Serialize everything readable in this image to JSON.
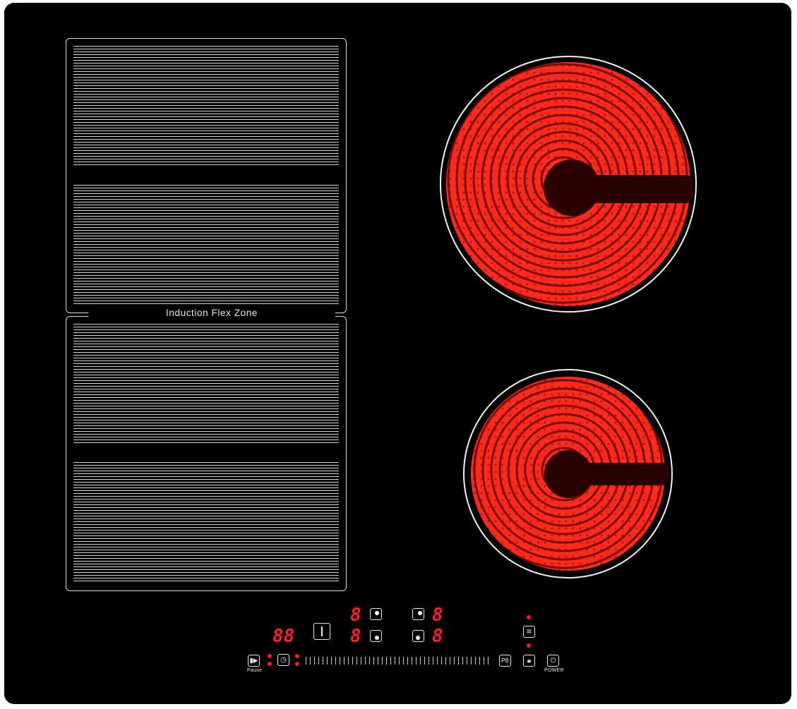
{
  "flex_zone": {
    "label": "Induction Flex Zone"
  },
  "controls": {
    "timer_display": "88",
    "zone_displays": {
      "front_left_top": "8",
      "front_left_bottom": "8",
      "rear_right_top": "8",
      "rear_right_bottom": "8"
    },
    "pause_label": "Pause",
    "power_label": "POWER",
    "pb_label": "PB"
  },
  "icons": {
    "pause": "pause-play-icon",
    "timer": "clock-icon",
    "bridge": "bridge-icon",
    "keep_warm": "keep-warm-icon",
    "lock": "lock-icon",
    "power": "power-icon"
  },
  "colors": {
    "glass": "#000000",
    "display_red": "#ff1e1e",
    "heating_red": "#ff2a1a",
    "outline": "#d9d9d9"
  }
}
